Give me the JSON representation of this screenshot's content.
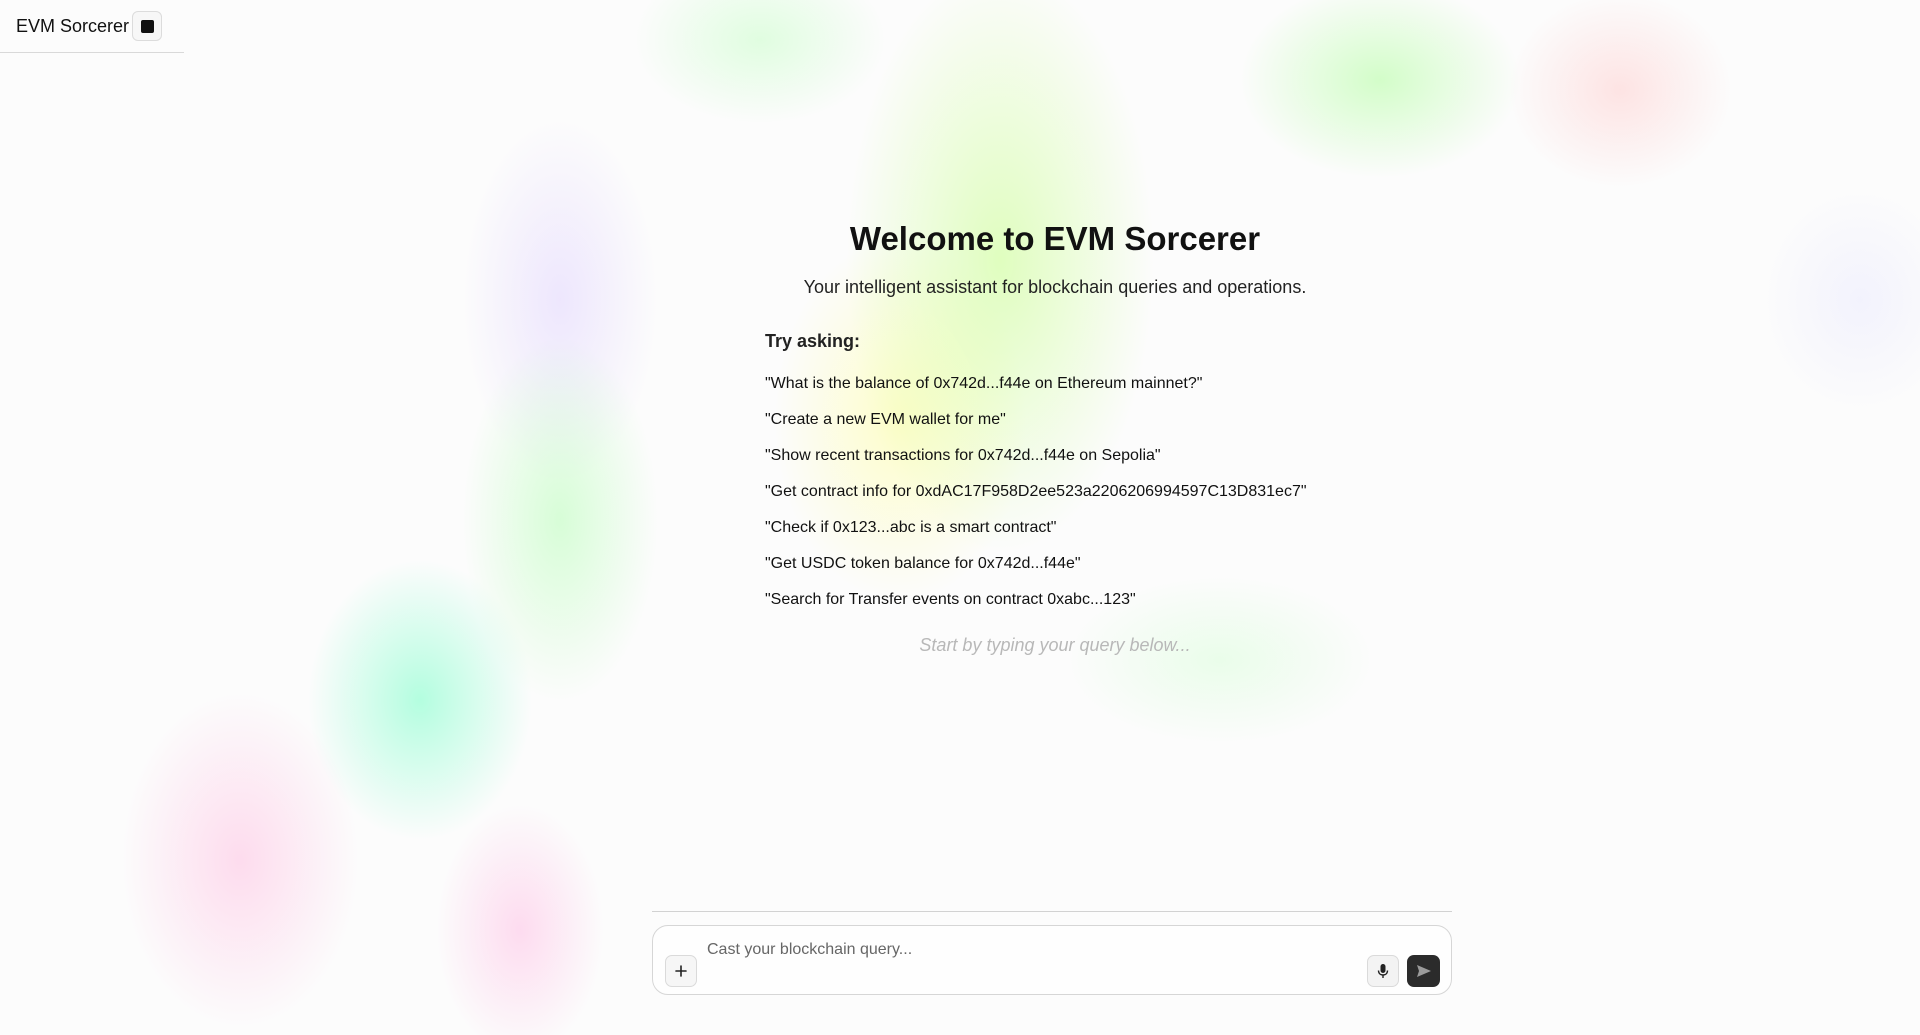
{
  "header": {
    "title": "EVM Sorcerer",
    "toggle_icon": "stop-square-icon"
  },
  "welcome": {
    "title": "Welcome to EVM Sorcerer",
    "subtitle": "Your intelligent assistant for blockchain queries and operations.",
    "try_label": "Try asking:",
    "examples": [
      "\"What is the balance of 0x742d...f44e on Ethereum mainnet?\"",
      "\"Create a new EVM wallet for me\"",
      "\"Show recent transactions for 0x742d...f44e on Sepolia\"",
      "\"Get contract info for 0xdAC17F958D2ee523a2206206994597C13D831ec7\"",
      "\"Check if 0x123...abc is a smart contract\"",
      "\"Get USDC token balance for 0x742d...f44e\"",
      "\"Search for Transfer events on contract 0xabc...123\""
    ],
    "hint": "Start by typing your query below..."
  },
  "composer": {
    "placeholder": "Cast your blockchain query...",
    "value": "",
    "attach_icon": "plus-icon",
    "mic_icon": "microphone-icon",
    "send_icon": "send-icon"
  },
  "colors": {
    "accent_dark": "#2b2b2b",
    "hint": "#b8b8b8",
    "border": "#d6d6d6"
  }
}
